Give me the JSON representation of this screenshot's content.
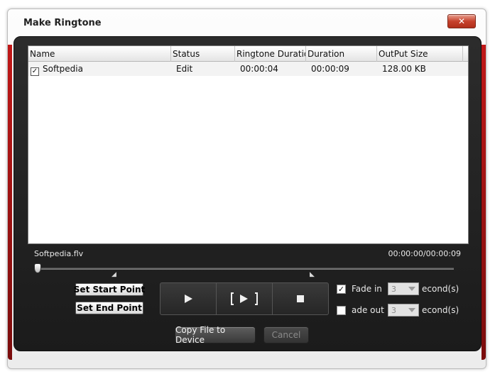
{
  "window": {
    "title": "Make Ringtone",
    "close_glyph": "✕"
  },
  "table": {
    "columns": [
      "Name",
      "Status",
      "Ringtone Duration",
      "Duration",
      "OutPut Size"
    ],
    "rows": [
      {
        "checked": true,
        "name": "Softpedia",
        "status": "Edit",
        "ringtone_duration": "00:00:04",
        "duration": "00:00:09",
        "size": "128.00 KB"
      }
    ],
    "check_glyph": "✓"
  },
  "player": {
    "file_name": "Softpedia.flv",
    "time": "00:00:00/00:00:09",
    "position_fraction": 0,
    "start_marker_glyph": "◢",
    "end_marker_glyph": "◣"
  },
  "controls": {
    "set_start_label": "Set Start Point",
    "set_end_label": "Set End Point",
    "play_icon": "play-icon",
    "play_range_icon": "play-range-icon",
    "stop_icon": "stop-icon"
  },
  "fade": {
    "fade_in": {
      "checked": true,
      "label": "Fade in",
      "value": "3",
      "unit": "econd(s)"
    },
    "fade_out": {
      "checked": false,
      "label": "ade out",
      "value": "3",
      "unit": "econd(s)"
    }
  },
  "buttons": {
    "copy": "Copy File to Device",
    "cancel": "Cancel"
  },
  "colors": {
    "panel": "#1f1f1f",
    "accent_red": "#b01414",
    "close_red": "#c6412c"
  }
}
